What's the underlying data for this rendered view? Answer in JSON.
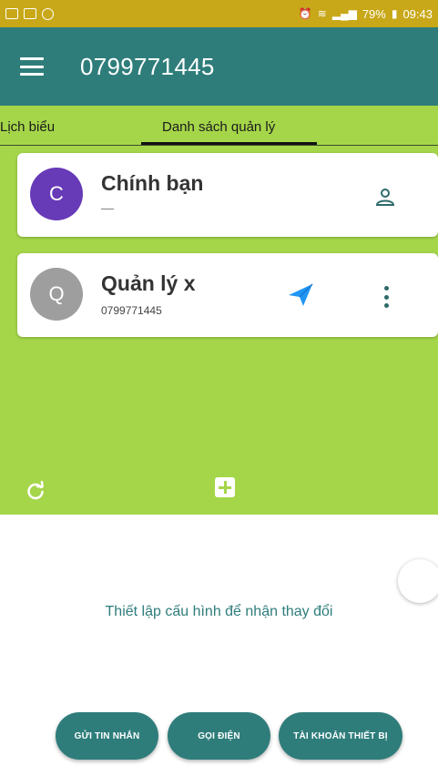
{
  "status_bar": {
    "battery": "79%",
    "time": "09:43"
  },
  "appbar": {
    "title": "0799771445"
  },
  "tabs": [
    {
      "label": "Lịch biểu"
    },
    {
      "label": "Danh sách quản lý"
    }
  ],
  "contacts": [
    {
      "initial": "C",
      "name": "Chính bạn",
      "detail": "—"
    },
    {
      "initial": "Q",
      "name": "Quản lý x",
      "detail": "0799771445"
    }
  ],
  "config_message": "Thiết lập cấu hình để nhận thay đổi",
  "actions": {
    "send_message": "GỬI TIN NHẮN",
    "call": "GỌI ĐIỆN",
    "device_account": "TÀI KHOẢN THIẾT BỊ"
  },
  "colors": {
    "status_bar": "#c8a818",
    "app_bar": "#2e7d7b",
    "content_bg": "#a5d64a",
    "avatar_1": "#673ab7",
    "avatar_2": "#9e9e9e",
    "send_accent": "#2196f3"
  },
  "icons": [
    "menu-icon",
    "person-icon",
    "send-icon",
    "more-vert-icon",
    "refresh-icon",
    "add-box-icon"
  ]
}
